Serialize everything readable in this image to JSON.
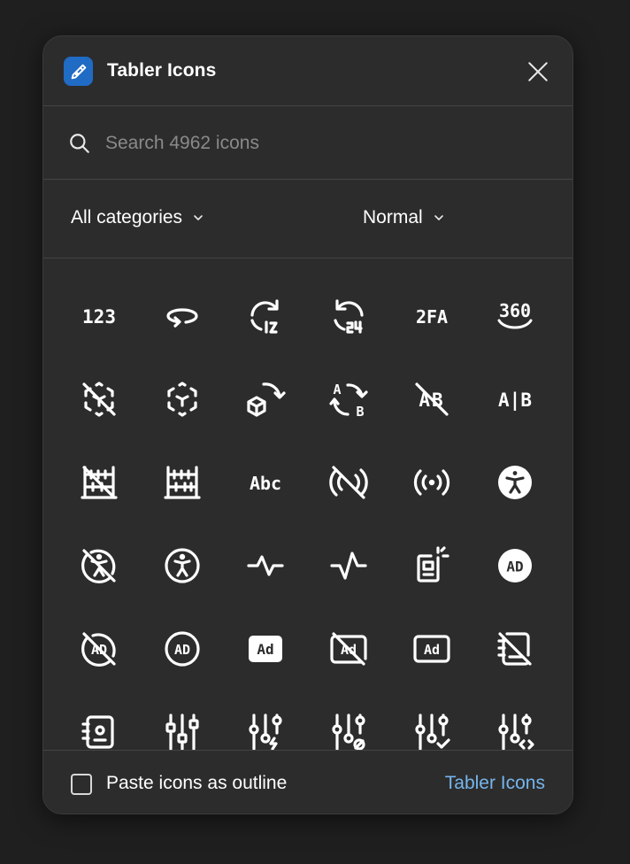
{
  "app": {
    "title": "Tabler Icons",
    "logo_icon": "pen-nib-icon",
    "accent_color": "#206bc4"
  },
  "search": {
    "placeholder": "Search 4962 icons",
    "value": ""
  },
  "filters": {
    "category": "All categories",
    "style": "Normal"
  },
  "icons": [
    "123-icon",
    "360-rotate-icon",
    "clock-rotate-12-icon",
    "clock-rotate-24-icon",
    "2fa-icon",
    "360-view-icon",
    "3d-cube-sphere-off-icon",
    "3d-cube-sphere-icon",
    "3d-rotate-icon",
    "a-b-2-icon",
    "a-b-off-icon",
    "a-b-icon",
    "abacus-off-icon",
    "abacus-icon",
    "abc-icon",
    "access-point-off-icon",
    "access-point-icon",
    "accessible-filled-icon",
    "accessible-off-icon",
    "accessible-icon",
    "activity-heartbeat-icon",
    "activity-icon",
    "ad-2-icon",
    "ad-circle-filled-icon",
    "ad-circle-off-icon",
    "ad-circle-icon",
    "ad-filled-icon",
    "ad-off-icon",
    "ad-icon",
    "address-book-off-icon",
    "address-book-icon",
    "adjustments-alt-icon",
    "adjustments-bolt-icon",
    "adjustments-cancel-icon",
    "adjustments-check-icon",
    "adjustments-code-icon"
  ],
  "icon_labels": {
    "num": "123",
    "twofa": "2FA",
    "three60": "360",
    "abc": "Abc",
    "ad": "AD",
    "adsq": "Ad",
    "a": "A",
    "b": "B",
    "ab": "A|B",
    "ab_off": "AB"
  },
  "footer": {
    "checkbox_label": "Paste icons as outline",
    "checkbox_checked": false,
    "link": "Tabler Icons",
    "link_color": "#76b5ec"
  }
}
